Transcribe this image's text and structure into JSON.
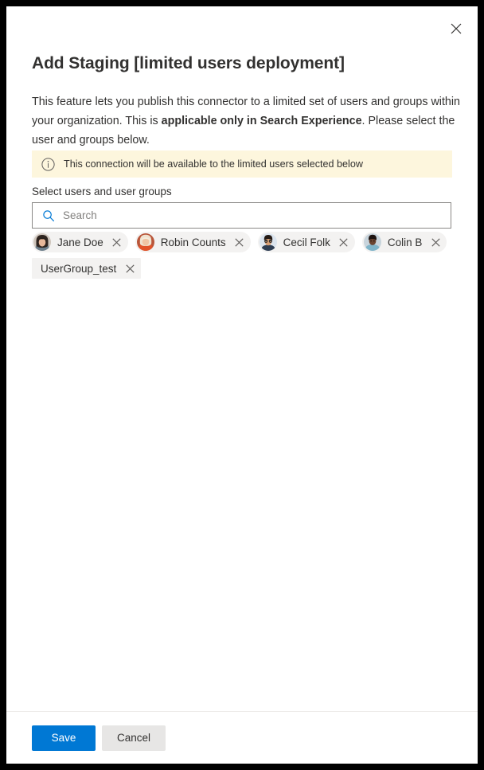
{
  "panel": {
    "close_icon": "close-icon",
    "title": "Add Staging [limited users deployment]",
    "description_part1": "This feature lets you publish this connector to a limited set of users and groups within your organization. This is ",
    "description_bold": "applicable only in Search Experience",
    "description_part2": ". Please select the user and groups below."
  },
  "info_bar": {
    "icon": "info-circle-icon",
    "text": "This connection will be available to the limited users selected below",
    "background_color": "#fdf6dd"
  },
  "picker": {
    "label": "Select users and user groups",
    "search": {
      "icon": "search-icon",
      "placeholder": "Search",
      "value": ""
    },
    "chips": [
      {
        "label": "Jane Doe",
        "type": "person",
        "avatar": "avatar-jane-doe",
        "remove_icon": "close-icon"
      },
      {
        "label": "Robin Counts",
        "type": "person",
        "avatar": "avatar-robin-counts",
        "remove_icon": "close-icon"
      },
      {
        "label": "Cecil Folk",
        "type": "person",
        "avatar": "avatar-cecil-folk",
        "remove_icon": "close-icon"
      },
      {
        "label": "Colin B",
        "type": "person",
        "avatar": "avatar-colin-b",
        "remove_icon": "close-icon"
      },
      {
        "label": "UserGroup_test",
        "type": "group",
        "avatar": null,
        "remove_icon": "close-icon"
      }
    ]
  },
  "footer": {
    "save_label": "Save",
    "cancel_label": "Cancel",
    "primary_color": "#0078d4"
  }
}
